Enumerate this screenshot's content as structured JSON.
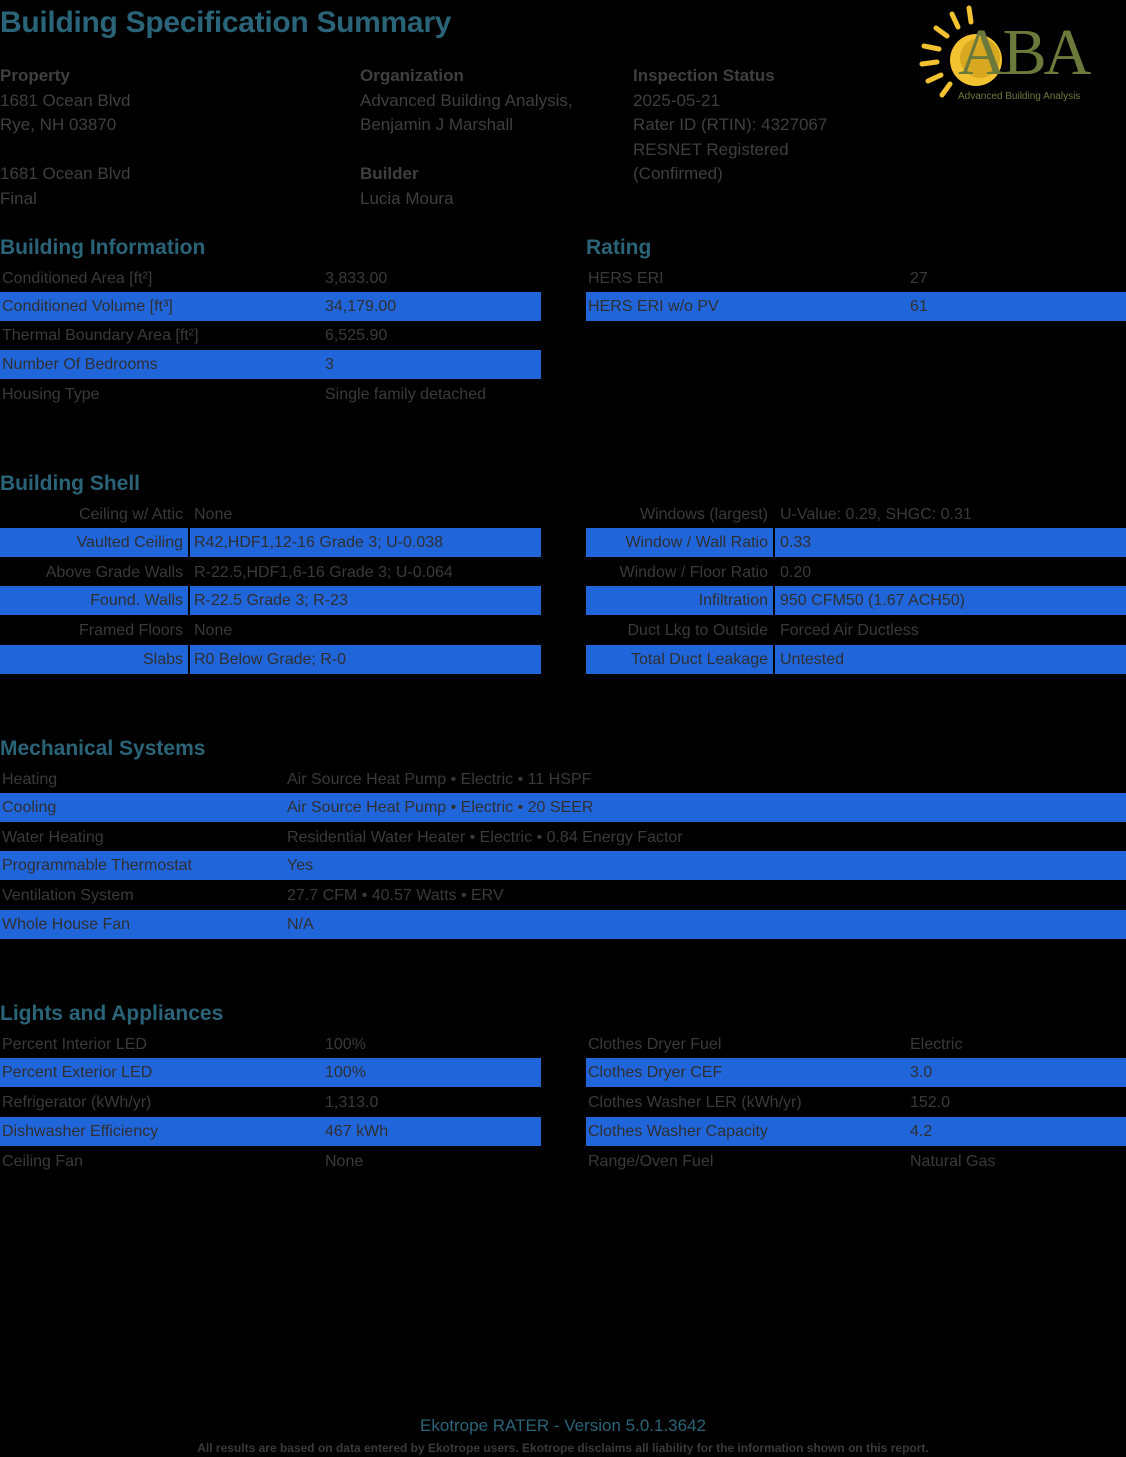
{
  "title": "Building Specification Summary",
  "logo": {
    "text": "ABA",
    "subtext": "Advanced Building Analysis",
    "sun_color": "#f2c230",
    "text_color": "#6b7a3a"
  },
  "header": {
    "property": {
      "label": "Property",
      "lines": [
        "1681 Ocean Blvd",
        "Rye, NH 03870",
        "",
        "1681 Ocean Blvd",
        "Final"
      ]
    },
    "organization": {
      "label": "Organization",
      "line1": "Advanced Building Analysis,",
      "line2": "Benjamin J Marshall",
      "builder_label": "Builder",
      "builder": "Lucia Moura"
    },
    "inspection": {
      "label": "Inspection Status",
      "lines": [
        "2025-05-21",
        "Rater ID (RTIN): 4327067",
        "RESNET Registered",
        "(Confirmed)"
      ]
    }
  },
  "building_information": {
    "title": "Building Information",
    "rows": [
      {
        "k": "Conditioned Area [ft²]",
        "v": "3,833.00"
      },
      {
        "k": "Conditioned Volume [ft³]",
        "v": "34,179.00"
      },
      {
        "k": "Thermal Boundary Area [ft²]",
        "v": "6,525.90"
      },
      {
        "k": "Number Of Bedrooms",
        "v": "3"
      },
      {
        "k": "Housing Type",
        "v": "Single family detached"
      }
    ]
  },
  "rating": {
    "title": "Rating",
    "rows": [
      {
        "k": "HERS ERI",
        "v": "27"
      },
      {
        "k": "HERS ERI w/o PV",
        "v": "61"
      }
    ]
  },
  "building_shell": {
    "title": "Building Shell",
    "left": [
      {
        "k": "Ceiling w/ Attic",
        "v": "None"
      },
      {
        "k": "Vaulted Ceiling",
        "v": "R42,HDF1,12-16 Grade 3; U-0.038"
      },
      {
        "k": "Above Grade Walls",
        "v": "R-22.5,HDF1,6-16 Grade 3; U-0.064"
      },
      {
        "k": "Found. Walls",
        "v": "R-22.5 Grade 3; R-23"
      },
      {
        "k": "Framed Floors",
        "v": "None"
      },
      {
        "k": "Slabs",
        "v": "R0 Below Grade; R-0"
      }
    ],
    "right": [
      {
        "k": "Windows (largest)",
        "v": "U-Value: 0.29, SHGC: 0.31"
      },
      {
        "k": "Window / Wall Ratio",
        "v": "0.33"
      },
      {
        "k": "Window / Floor Ratio",
        "v": "0.20"
      },
      {
        "k": "Infiltration",
        "v": "950 CFM50 (1.67 ACH50)"
      },
      {
        "k": "Duct Lkg to Outside",
        "v": "Forced Air Ductless"
      },
      {
        "k": "Total Duct Leakage",
        "v": "Untested"
      }
    ]
  },
  "mechanical": {
    "title": "Mechanical Systems",
    "rows": [
      {
        "k": "Heating",
        "v": "Air Source Heat Pump • Electric • 11 HSPF"
      },
      {
        "k": "Cooling",
        "v": "Air Source Heat Pump • Electric • 20 SEER"
      },
      {
        "k": "Water Heating",
        "v": "Residential Water Heater • Electric • 0.84 Energy Factor"
      },
      {
        "k": "Programmable Thermostat",
        "v": "Yes"
      },
      {
        "k": "Ventilation System",
        "v": "27.7 CFM • 40.57 Watts • ERV"
      },
      {
        "k": "Whole House Fan",
        "v": "N/A"
      }
    ]
  },
  "lights": {
    "title": "Lights and Appliances",
    "left": [
      {
        "k": "Percent Interior LED",
        "v": "100%"
      },
      {
        "k": "Percent Exterior LED",
        "v": "100%"
      },
      {
        "k": "Refrigerator (kWh/yr)",
        "v": "1,313.0"
      },
      {
        "k": "Dishwasher Efficiency",
        "v": "467 kWh"
      },
      {
        "k": "Ceiling Fan",
        "v": "None"
      }
    ],
    "right": [
      {
        "k": "Clothes Dryer Fuel",
        "v": "Electric"
      },
      {
        "k": "Clothes Dryer CEF",
        "v": "3.0"
      },
      {
        "k": "Clothes Washer LER (kWh/yr)",
        "v": "152.0"
      },
      {
        "k": "Clothes Washer Capacity",
        "v": "4.2"
      },
      {
        "k": "Range/Oven Fuel",
        "v": "Natural Gas"
      }
    ]
  },
  "footer": {
    "version": "Ekotrope RATER - Version 5.0.1.3642",
    "disclaimer": "All results are based on data entered by Ekotrope users. Ekotrope disclaims all liability for the information shown on this report."
  }
}
